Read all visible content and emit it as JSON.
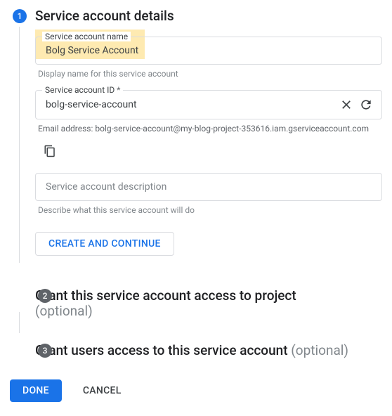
{
  "step1": {
    "badge": "1",
    "title": "Service account details",
    "name_label": "Service account name",
    "name_value": "Bolg Service Account",
    "name_hint": "Display name for this service account",
    "id_label": "Service account ID",
    "id_req": "*",
    "id_value": "bolg-service-account",
    "email_label": "Email address: bolg-service-account@my-blog-project-353616.iam.gserviceaccount.com",
    "desc_placeholder": "Service account description",
    "desc_hint": "Describe what this service account will do",
    "create_btn": "CREATE AND CONTINUE"
  },
  "step2": {
    "badge": "2",
    "title": "Grant this service account access to project",
    "optional": "(optional)"
  },
  "step3": {
    "badge": "3",
    "title": "Grant users access to this service account",
    "optional": "(optional)"
  },
  "footer": {
    "done": "DONE",
    "cancel": "CANCEL"
  }
}
